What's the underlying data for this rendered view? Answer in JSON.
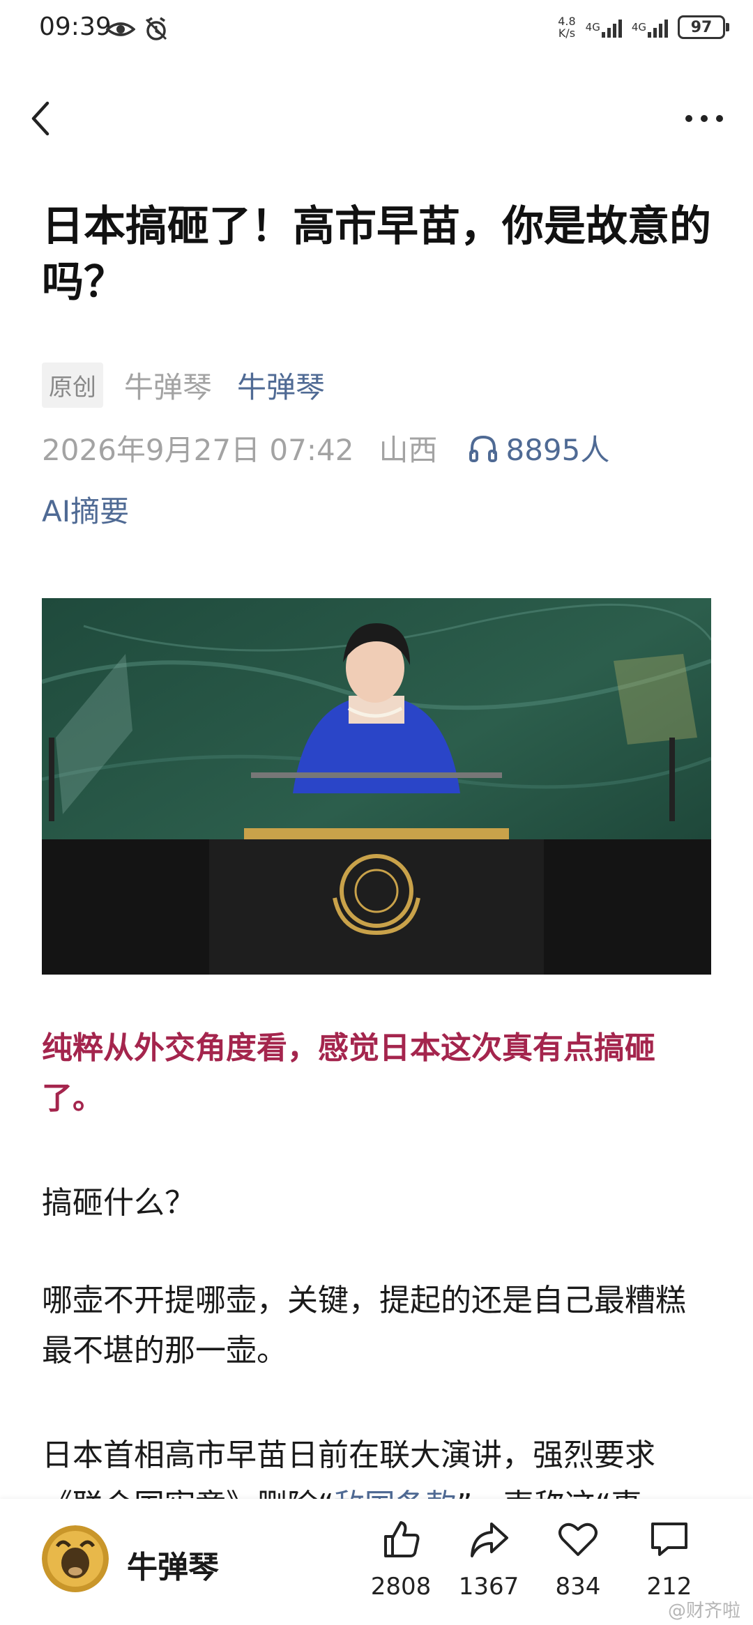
{
  "status_bar": {
    "time": "09:39",
    "net_speed_top": "4.8",
    "net_speed_bottom": "K/s",
    "signal1_label": "4G",
    "signal2_label": "4G",
    "battery": "97"
  },
  "article": {
    "title": "日本搞砸了！高市早苗，你是故意的吗？",
    "badge": "原创",
    "author_gray": "牛弹琴",
    "author_link": "牛弹琴",
    "datetime": "2026年9月27日 07:42",
    "location": "山西",
    "listeners": "8895人",
    "ai_summary": "AI摘要",
    "lead": "纯粹从外交角度看，感觉日本这次真有点搞砸了。",
    "p1": "搞砸什么？",
    "p2": "哪壶不开提哪壶，关键，提起的还是自己最糟糕最不堪的那一壶。",
    "p3_a": "日本首相高市早苗日前在联大演讲，强烈要求《联合国宪章》删除“",
    "p3_hl": "敌国条款",
    "p3_b": "”，声称这“事"
  },
  "bottom_bar": {
    "author": "牛弹琴",
    "likes": "2808",
    "shares": "1367",
    "favorites": "834",
    "comments": "212",
    "watermark": "@财齐啦"
  },
  "colors": {
    "accent_blue": "#4f6a94",
    "lead_red": "#a4254d",
    "meta_gray": "#a3a3a3"
  },
  "icons": [
    "eye-icon",
    "alarm-icon",
    "back-icon",
    "more-icon",
    "headphones-icon",
    "thumbs-up-icon",
    "share-icon",
    "heart-icon",
    "comment-icon"
  ]
}
